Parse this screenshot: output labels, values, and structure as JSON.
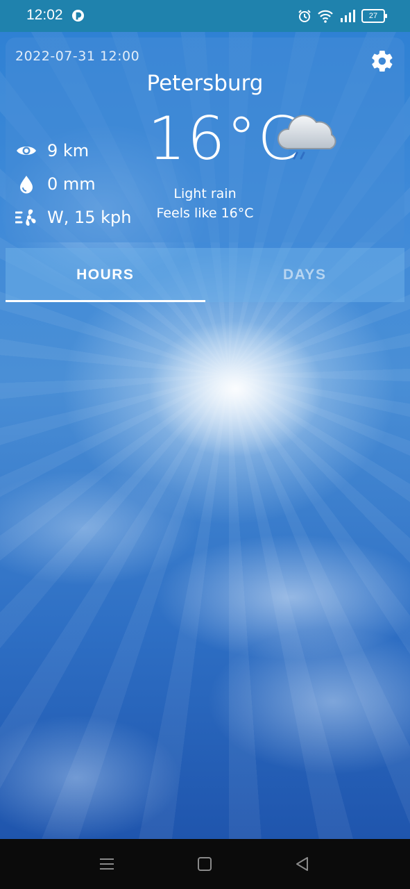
{
  "status_bar": {
    "time": "12:02",
    "battery_level": "27",
    "icons": [
      "app-notification-icon",
      "alarm-icon",
      "wifi-icon",
      "signal-icon",
      "battery-icon"
    ]
  },
  "weather": {
    "datetime": "2022-07-31 12:00",
    "city": "Petersburg",
    "temperature": "16°C",
    "condition": "Light rain",
    "feels_like": "Feels like 16°C",
    "condition_icon": "light-rain-cloud-icon",
    "stats": {
      "visibility": "9 km",
      "precipitation": "0 mm",
      "wind": "W, 15 kph"
    }
  },
  "tabs": [
    {
      "label": "HOURS",
      "active": true
    },
    {
      "label": "DAYS",
      "active": false
    }
  ],
  "nav_bar": {
    "icons": [
      "menu-icon",
      "home-icon",
      "back-icon"
    ]
  },
  "colors": {
    "status_bar": "#1f82ad",
    "card_overlay": "#468cd7",
    "text": "#ffffff"
  }
}
